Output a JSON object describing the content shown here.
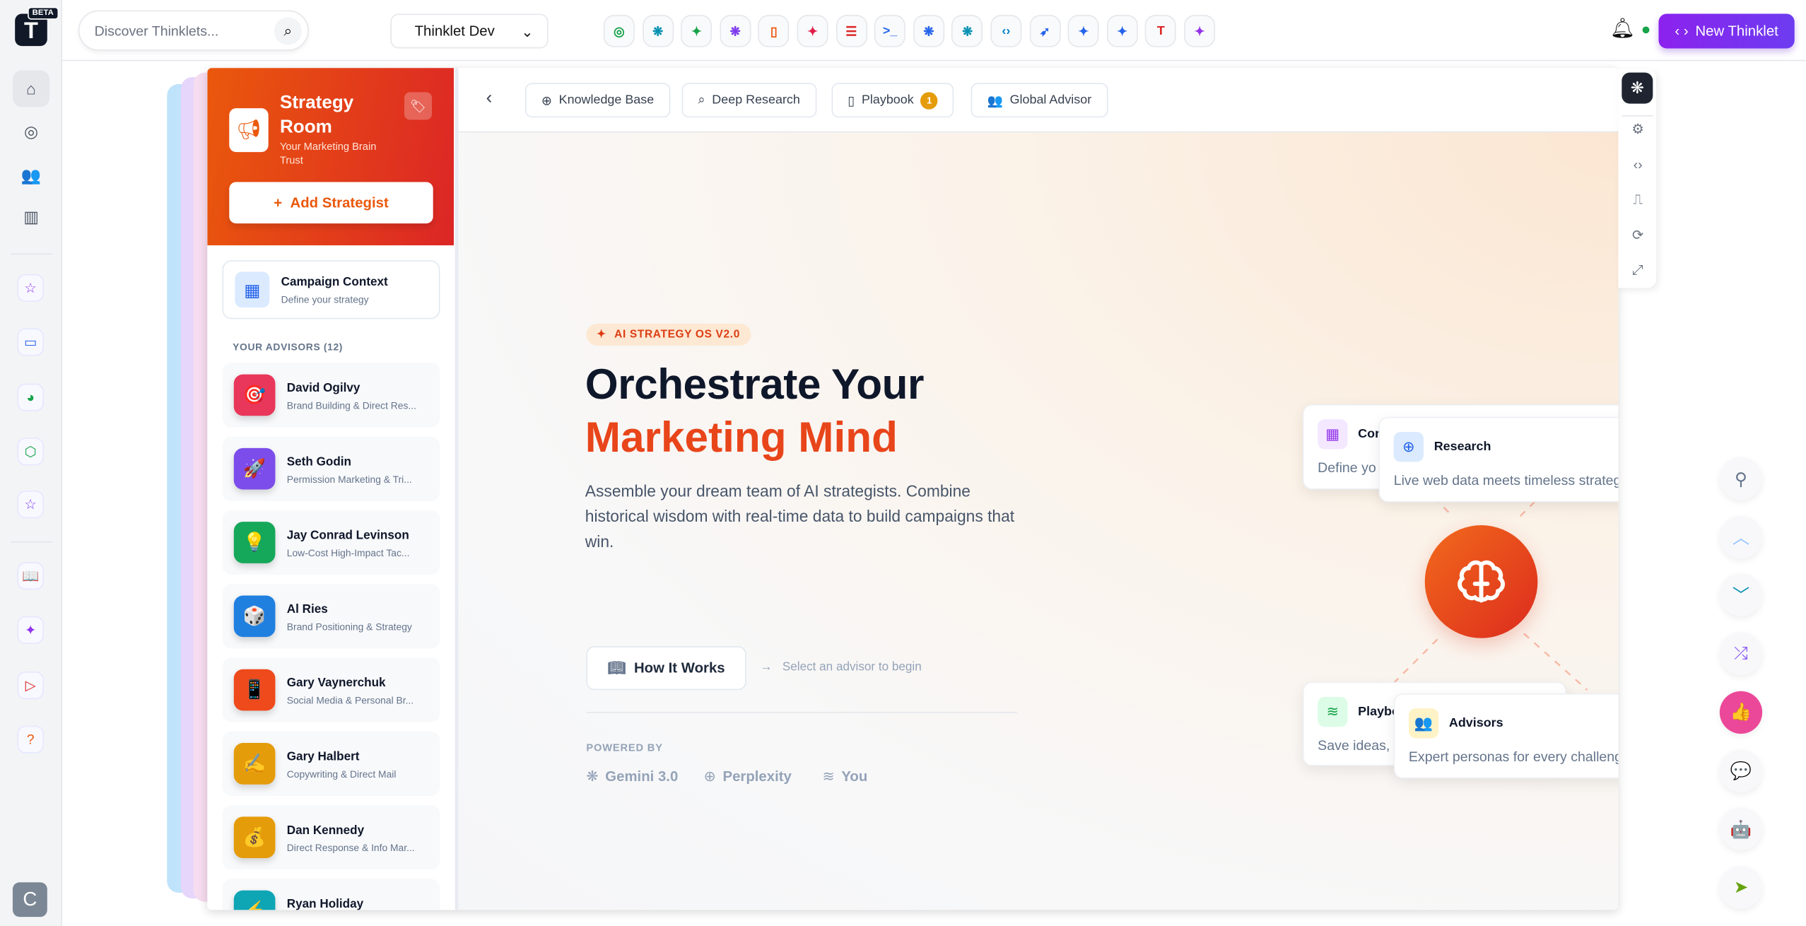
{
  "app": {
    "logo_letter": "T",
    "beta": "BETA"
  },
  "rail": {
    "nav": [
      {
        "icon": "home-icon",
        "glyph": "⌂"
      },
      {
        "icon": "compass-icon",
        "glyph": "◎"
      },
      {
        "icon": "users-icon",
        "glyph": "👥"
      },
      {
        "icon": "library-icon",
        "glyph": "▥"
      }
    ],
    "apps": [
      {
        "icon": "star-icon",
        "glyph": "☆",
        "color": "#9333ea"
      },
      {
        "icon": "laptop-icon",
        "glyph": "▭",
        "color": "#2563eb"
      },
      {
        "icon": "palette-icon",
        "glyph": "◕",
        "color": "#16a34a"
      },
      {
        "icon": "box-icon",
        "glyph": "⬡",
        "color": "#16a34a"
      },
      {
        "icon": "star-icon",
        "glyph": "☆",
        "color": "#7c3aed"
      }
    ],
    "extras": [
      {
        "icon": "book-icon",
        "glyph": "📖",
        "color": "#16a34a"
      },
      {
        "icon": "sparkles-icon",
        "glyph": "✦",
        "color": "#9333ea"
      },
      {
        "icon": "play-icon",
        "glyph": "▷",
        "color": "#dc2626"
      },
      {
        "icon": "help-icon",
        "glyph": "?",
        "color": "#ea580c"
      }
    ],
    "user_initial": "C"
  },
  "topbar": {
    "search_placeholder": "Discover Thinklets...",
    "workspace": "Thinklet Dev",
    "new_button": "New Thinklet",
    "quick_icons": [
      {
        "icon": "target-icon",
        "glyph": "◎",
        "color": "#16a34a"
      },
      {
        "icon": "brain-icon",
        "glyph": "❋",
        "color": "#0891b2"
      },
      {
        "icon": "sparkle-icon",
        "glyph": "✦",
        "color": "#16a34a"
      },
      {
        "icon": "brain-icon",
        "glyph": "❋",
        "color": "#7c3aed"
      },
      {
        "icon": "book-icon",
        "glyph": "▯",
        "color": "#ea580c"
      },
      {
        "icon": "sparkle-icon",
        "glyph": "✦",
        "color": "#e11d48"
      },
      {
        "icon": "sliders-icon",
        "glyph": "☰",
        "color": "#dc2626"
      },
      {
        "icon": "terminal-icon",
        "glyph": ">_",
        "color": "#2563eb"
      },
      {
        "icon": "brain-icon",
        "glyph": "❋",
        "color": "#2563eb"
      },
      {
        "icon": "brain-icon",
        "glyph": "❋",
        "color": "#0891b2"
      },
      {
        "icon": "code-icon",
        "glyph": "‹›",
        "color": "#0284c7"
      },
      {
        "icon": "rocket-icon",
        "glyph": "➶",
        "color": "#2563eb"
      },
      {
        "icon": "sparkle-icon",
        "glyph": "✦",
        "color": "#2563eb"
      },
      {
        "icon": "sparkle-icon",
        "glyph": "✦",
        "color": "#2563eb"
      },
      {
        "icon": "text-icon",
        "glyph": "T",
        "color": "#dc2626"
      },
      {
        "icon": "sparkle-icon",
        "glyph": "✦",
        "color": "#9333ea"
      }
    ]
  },
  "panel": {
    "title": "Strategy Room",
    "subtitle": "Your Marketing Brain Trust",
    "add_button": "Add Strategist",
    "context": {
      "title": "Campaign Context",
      "subtitle": "Define your strategy"
    },
    "advisors_header": "YOUR ADVISORS (12)",
    "advisors": [
      {
        "name": "David Ogilvy",
        "desc": "Brand Building & Direct Res...",
        "emoji": "🎯",
        "color": "#e8375a"
      },
      {
        "name": "Seth Godin",
        "desc": "Permission Marketing & Tri...",
        "emoji": "🚀",
        "color": "#7c4dea"
      },
      {
        "name": "Jay Conrad Levinson",
        "desc": "Low-Cost High-Impact Tac...",
        "emoji": "💡",
        "color": "#16a85a"
      },
      {
        "name": "Al Ries",
        "desc": "Brand Positioning & Strategy",
        "emoji": "🎲",
        "color": "#2080e0"
      },
      {
        "name": "Gary Vaynerchuk",
        "desc": "Social Media & Personal Br...",
        "emoji": "📱",
        "color": "#ee4a1c"
      },
      {
        "name": "Gary Halbert",
        "desc": "Copywriting & Direct Mail",
        "emoji": "✍",
        "color": "#e59c0b"
      },
      {
        "name": "Dan Kennedy",
        "desc": "Direct Response & Info Mar...",
        "emoji": "💰",
        "color": "#e59c0b"
      },
      {
        "name": "Ryan Holiday",
        "desc": "",
        "emoji": "⚡",
        "color": "#0ea5b5"
      }
    ]
  },
  "tabs": [
    {
      "label": "Knowledge Base",
      "glyph": "⊕"
    },
    {
      "label": "Deep Research",
      "glyph": "⌕"
    },
    {
      "label": "Playbook",
      "glyph": "▯",
      "badge": "1"
    },
    {
      "label": "Global Advisor",
      "glyph": "👥"
    }
  ],
  "hero": {
    "badge": "AI STRATEGY OS V2.0",
    "line1": "Orchestrate Your",
    "line2": "Marketing Mind",
    "paragraph": "Assemble your dream team of AI strategists. Combine historical wisdom with real-time data to build campaigns that win.",
    "how_button": "How It Works",
    "hint": "Select an advisor to begin",
    "powered_by": "POWERED BY",
    "providers": [
      {
        "name": "Gemini 3.0",
        "glyph": "❋"
      },
      {
        "name": "Perplexity",
        "glyph": "⊕"
      },
      {
        "name": "You",
        "glyph": "≋"
      }
    ]
  },
  "diagram": [
    {
      "title": "Context",
      "visible_title": "Con",
      "desc": "Define yo",
      "color": "#9333ea",
      "bg": "#f3e8ff",
      "glyph": "▦"
    },
    {
      "title": "Research",
      "visible_title": "Research",
      "desc": "Live web data meets timeless strategy.",
      "color": "#2563eb",
      "bg": "#dbeafe",
      "glyph": "⊕"
    },
    {
      "title": "Playbook",
      "visible_title": "Playbo",
      "desc": "Save ideas,",
      "color": "#16a34a",
      "bg": "#dcfce7",
      "glyph": "≋"
    },
    {
      "title": "Advisors",
      "visible_title": "Advisors",
      "desc": "Expert personas for every challenge.",
      "color": "#d97706",
      "bg": "#fef3c7",
      "glyph": "👥"
    }
  ],
  "tools": [
    {
      "icon": "settings-icon",
      "glyph": "⚙"
    },
    {
      "icon": "code-icon",
      "glyph": "‹›"
    },
    {
      "icon": "bookmark-icon",
      "glyph": "⎍"
    },
    {
      "icon": "refresh-icon",
      "glyph": "⟳"
    },
    {
      "icon": "expand-icon",
      "glyph": "⤢"
    }
  ],
  "fabs": [
    {
      "icon": "sliders-icon",
      "glyph": "⚲",
      "color": "#64748b"
    },
    {
      "icon": "chevron-up-icon",
      "glyph": "︿",
      "color": "#93c5fd"
    },
    {
      "icon": "chevron-down-icon",
      "glyph": "﹀",
      "color": "#0891b2"
    },
    {
      "icon": "shuffle-icon",
      "glyph": "⤮",
      "color": "#8b5cf6"
    },
    {
      "icon": "thumbs-up-icon",
      "glyph": "👍",
      "color": "#ffffff",
      "bg": "#ec4899"
    },
    {
      "icon": "chat-icon",
      "glyph": "💬",
      "color": "#6d28d9"
    },
    {
      "icon": "bot-icon",
      "glyph": "🤖",
      "color": "#ea580c"
    },
    {
      "icon": "send-icon",
      "glyph": "➤",
      "color": "#65a30d"
    }
  ]
}
